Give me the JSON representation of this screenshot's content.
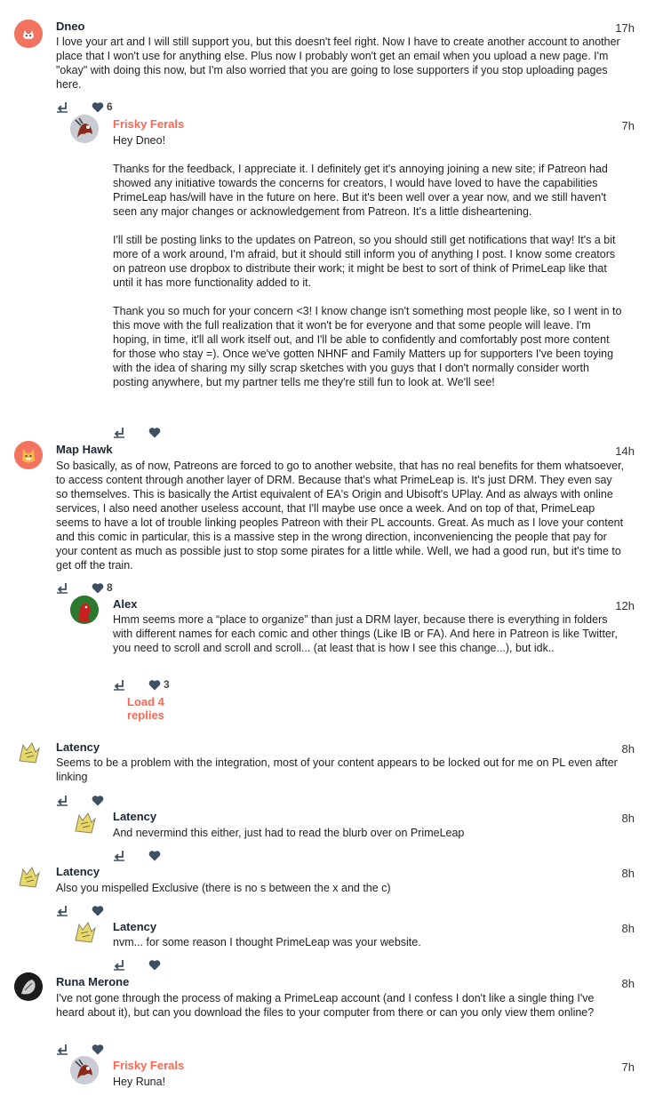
{
  "comments": [
    {
      "author": "Dneo",
      "time": "17h",
      "body": [
        "I love your art and I will still support you, but this doesn't feel right. Now I have to create another account to another place that I won't use for anything else. Plus now I probably won't get an email when you upload a new page. I'm \"okay\" with doing this now, but I'm also worried that you are going to lose supporters if you stop uploading pages here."
      ],
      "likes": "6"
    },
    {
      "author": "Frisky Ferals",
      "time": "7h",
      "body": [
        "Hey Dneo!",
        "Thanks for the feedback, I appreciate it. I definitely get it's annoying joining a new site; if Patreon had showed any initiative towards the concerns for creators, I would have loved to have the capabilities PrimeLeap has/will have in the future on here. But it's been well over a year now, and we still haven't seen any major changes or acknowledgement from Patreon. It's a little disheartening.",
        "I'll still be posting links to the updates on Patreon, so you should still get notifications that way! It's a bit more of a work around, I'm afraid, but it should still inform you of anything I post. I know some creators on patreon use dropbox to distribute their work; it might be best to sort of think of PrimeLeap like that until it has more functionality added to it.",
        "Thank you so much for your concern <3! I know change isn't something most people like, so I went in to this move with the full realization that it won't be for everyone and that some people will leave. I'm hoping, in time, it'll all work itself out, and I'll be able to confidently and comfortably post more content for those who stay =). Once we've gotten NHNF and Family Matters up for supporters I've been toying with the idea of sharing my silly scrap sketches with you guys that I don't normally consider worth posting anywhere, but my partner tells me they're still fun to look at. We'll see!"
      ],
      "likes": ""
    },
    {
      "author": "Map Hawk",
      "time": "14h",
      "body": [
        "So basically, as of now, Patreons are forced to go to another website, that has no real benefits for them whatsoever, to access content through another layer of DRM. Because that's what PrimeLeap is. It's just DRM. They even say so themselves. This is basically the Artist equivalent of EA's Origin and Ubisoft's UPlay. And as always with online services, I also need another useless account, that I'll maybe use once a week. And on top of that, PrimeLeap seems to have a lot of trouble linking peoples Patreon with their PL accounts. Great. As much as I love your content and this comic in particular, this is a massive step in the wrong direction, inconveniencing the people that pay for your content as much as possible just to stop some pirates for a little while. Well, we had a good run, but it's time to get off the train."
      ],
      "likes": "8"
    },
    {
      "author": "Alex",
      "time": "12h",
      "body": [
        "Hmm seems more a “place to organize” than just a DRM layer, because there is everything in folders with different names for each comic and other things (Like IB or FA). And here in Patreon is like Twitter, you need to scroll and scroll and scroll... (at least that is how I see this change...), but idk.."
      ],
      "likes": "3",
      "load_more": "Load 4 replies"
    },
    {
      "author": "Latency",
      "time": "8h",
      "body": [
        "Seems to be a problem with the integration, most of your content appears to be locked out for me on PL even after linking"
      ],
      "likes": ""
    },
    {
      "author": "Latency",
      "time": "8h",
      "body": [
        "And nevermind this either, just had to read the blurb over on PrimeLeap"
      ],
      "likes": ""
    },
    {
      "author": "Latency",
      "time": "8h",
      "body": [
        "Also you mispelled Exclusive (there is no s between the x and the c)"
      ],
      "likes": ""
    },
    {
      "author": "Latency",
      "time": "8h",
      "body": [
        "nvm... for some reason I thought PrimeLeap was your website."
      ],
      "likes": ""
    },
    {
      "author": "Runa Merone",
      "time": "8h",
      "body": [
        "I've not gone through the process of making a PrimeLeap account (and I confess I don't like a single thing I've heard about it), but can you download the files to your computer from there or can you only view them online?"
      ],
      "likes": ""
    },
    {
      "author": "Frisky Ferals",
      "time": "7h",
      "body": [
        "Hey Runa!"
      ],
      "likes": ""
    }
  ],
  "colors": {
    "creator_name": "#f96854",
    "author_name": "#1b2733",
    "icon": "#3d4f61",
    "load_more": "#f96854"
  },
  "icons": {
    "reply": "reply-icon",
    "like": "heart-icon"
  }
}
